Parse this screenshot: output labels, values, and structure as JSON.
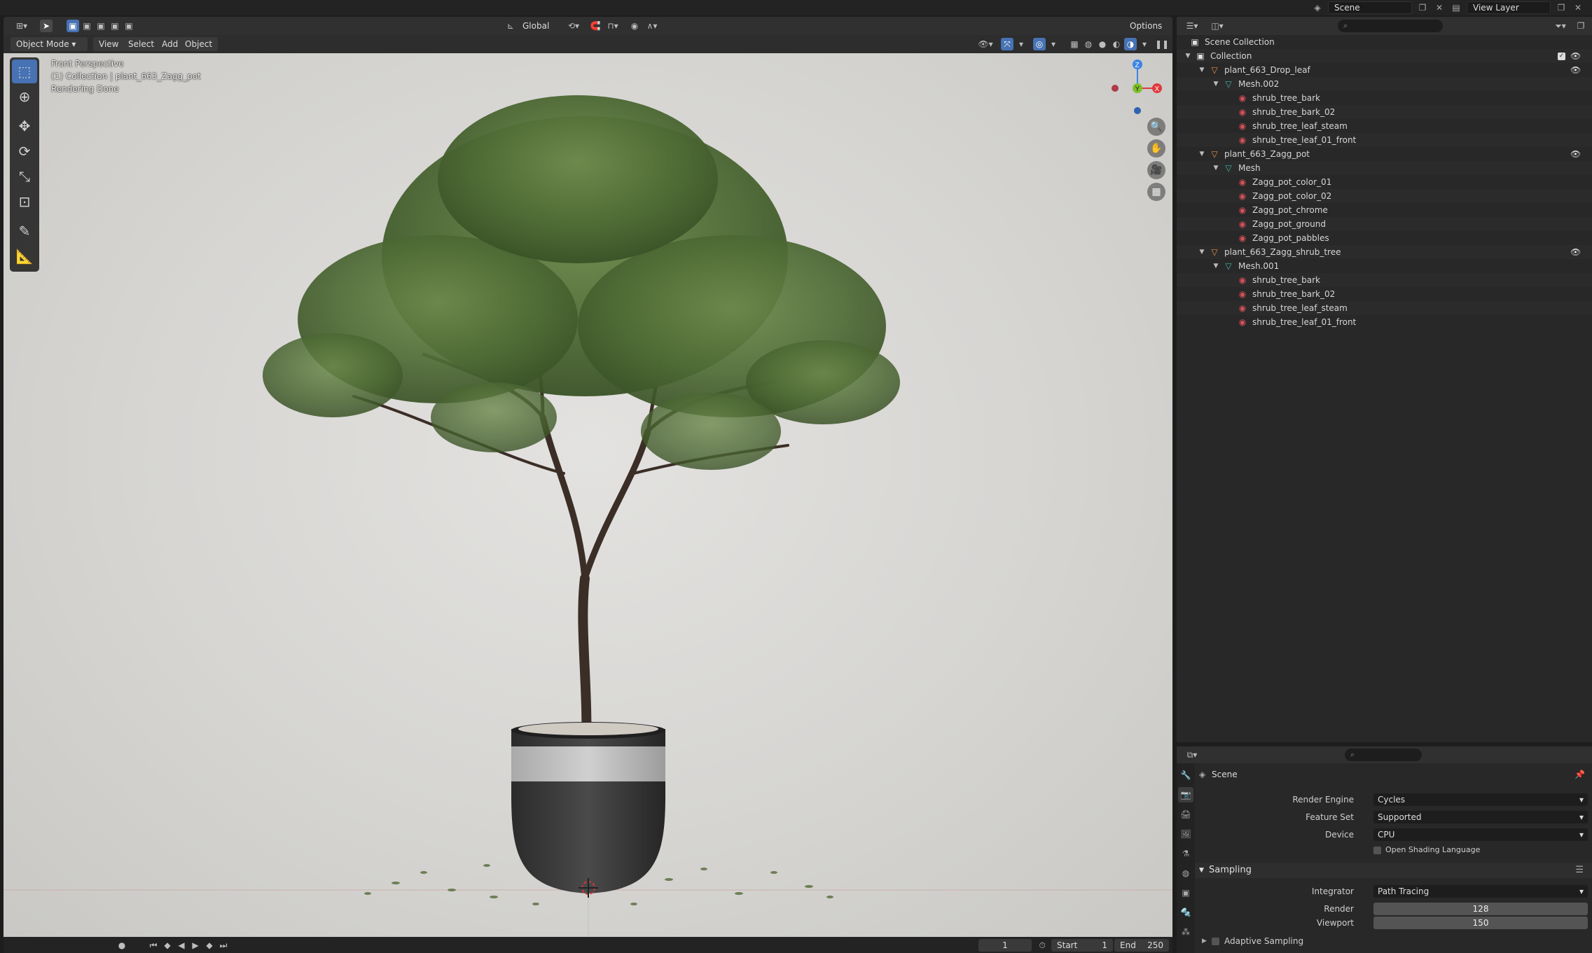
{
  "top_bar": {
    "scene_label": "Scene",
    "view_layer_label": "View Layer"
  },
  "viewport_header": {
    "transform_orientation": "Global",
    "options_label": "Options",
    "mode": "Object Mode",
    "menus": [
      "View",
      "Select",
      "Add",
      "Object"
    ]
  },
  "viewport_info": {
    "line1": "Front Perspective",
    "line2": "(1) Collection | plant_663_Zagg_pot",
    "line3": "Rendering Done"
  },
  "gizmo": {
    "z": "Z",
    "y": "Y",
    "x": "X"
  },
  "timeline": {
    "current_frame": "1",
    "start_label": "Start",
    "start_value": "1",
    "end_label": "End",
    "end_value": "250"
  },
  "outliner": {
    "root": "Scene Collection",
    "rows": [
      {
        "label": "Collection",
        "depth": 0,
        "type": "collection"
      },
      {
        "label": "plant_663_Drop_leaf",
        "depth": 1,
        "type": "object"
      },
      {
        "label": "Mesh.002",
        "depth": 2,
        "type": "mesh"
      },
      {
        "label": "shrub_tree_bark",
        "depth": 3,
        "type": "material"
      },
      {
        "label": "shrub_tree_bark_02",
        "depth": 3,
        "type": "material"
      },
      {
        "label": "shrub_tree_leaf_steam",
        "depth": 3,
        "type": "material"
      },
      {
        "label": "shrub_tree_leaf_01_front",
        "depth": 3,
        "type": "material"
      },
      {
        "label": "plant_663_Zagg_pot",
        "depth": 1,
        "type": "object"
      },
      {
        "label": "Mesh",
        "depth": 2,
        "type": "mesh"
      },
      {
        "label": "Zagg_pot_color_01",
        "depth": 3,
        "type": "material"
      },
      {
        "label": "Zagg_pot_color_02",
        "depth": 3,
        "type": "material"
      },
      {
        "label": "Zagg_pot_chrome",
        "depth": 3,
        "type": "material"
      },
      {
        "label": "Zagg_pot_ground",
        "depth": 3,
        "type": "material"
      },
      {
        "label": "Zagg_pot_pabbles",
        "depth": 3,
        "type": "material"
      },
      {
        "label": "plant_663_Zagg_shrub_tree",
        "depth": 1,
        "type": "object"
      },
      {
        "label": "Mesh.001",
        "depth": 2,
        "type": "mesh"
      },
      {
        "label": "shrub_tree_bark",
        "depth": 3,
        "type": "material"
      },
      {
        "label": "shrub_tree_bark_02",
        "depth": 3,
        "type": "material"
      },
      {
        "label": "shrub_tree_leaf_steam",
        "depth": 3,
        "type": "material"
      },
      {
        "label": "shrub_tree_leaf_01_front",
        "depth": 3,
        "type": "material"
      }
    ]
  },
  "properties": {
    "context": "Scene",
    "render_engine_label": "Render Engine",
    "render_engine_value": "Cycles",
    "feature_set_label": "Feature Set",
    "feature_set_value": "Supported",
    "device_label": "Device",
    "device_value": "CPU",
    "osl_label": "Open Shading Language",
    "sampling_title": "Sampling",
    "integrator_label": "Integrator",
    "integrator_value": "Path Tracing",
    "render_label": "Render",
    "render_value": "128",
    "viewport_label": "Viewport",
    "viewport_value": "150",
    "adaptive_label": "Adaptive Sampling"
  },
  "colors": {
    "accent": "#4772b3",
    "axis_x": "#e0393f",
    "axis_y": "#7fbf2a",
    "axis_z": "#3d84e6",
    "object_icon": "#e8904c",
    "mesh_icon": "#3fb8a8",
    "material_icon": "#d4505a"
  }
}
